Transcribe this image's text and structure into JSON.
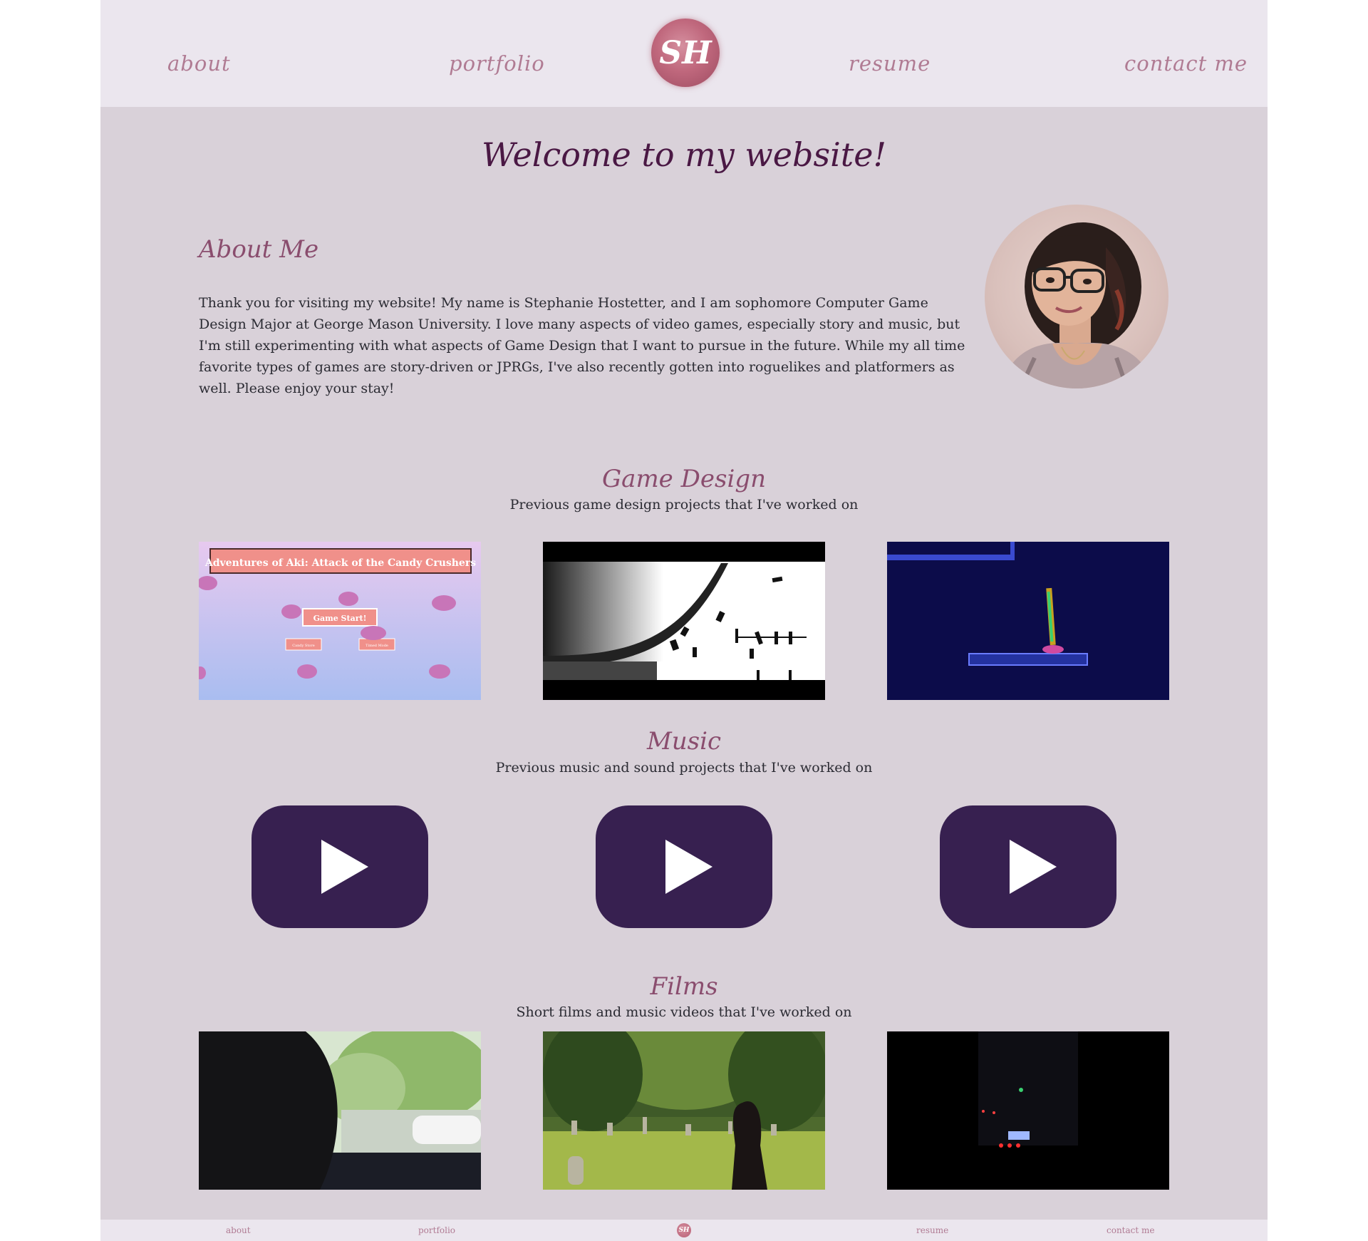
{
  "nav": {
    "about": "about",
    "portfolio": "portfolio",
    "logo_text": "SH",
    "resume": "resume",
    "contact": "contact me"
  },
  "hero": {
    "title": "Welcome to my website!"
  },
  "about": {
    "heading": "About Me",
    "body": "Thank you for visiting my website! My name is Stephanie Hostetter, and I am sophomore Computer Game Design Major at George Mason University. I love many aspects of video games, especially story and music, but I'm still experimenting with what aspects of Game Design that I want to pursue in the future. While my all time favorite types of games are story-driven or JPRGs, I've also recently gotten into roguelikes and platformers as well. Please enjoy your stay!"
  },
  "game_design": {
    "heading": "Game Design",
    "subtitle": "Previous game design projects that I've worked on",
    "aki": {
      "banner": "Adventures of Aki: Attack of the Candy Crushers",
      "start": "Game Start!",
      "candy_store": "Candy Store",
      "timed_mode": "Timed Mode"
    }
  },
  "music": {
    "heading": "Music",
    "subtitle": "Previous music and sound projects that I've worked on"
  },
  "films": {
    "heading": "Films",
    "subtitle": "Short films and music videos that I've worked on"
  },
  "footer": {
    "about": "about",
    "portfolio": "portfolio",
    "logo_text": "SH",
    "resume": "resume",
    "contact": "contact me"
  },
  "colors": {
    "page_bg": "#d9d1d9",
    "nav_bg": "#ebe6ee",
    "nav_link": "#b07b93",
    "heading_dark": "#4a1844",
    "heading": "#8a4d6e",
    "play_button": "#372050"
  },
  "icons": {
    "logo": "sh-monogram-logo",
    "play": "youtube-play-icon"
  }
}
